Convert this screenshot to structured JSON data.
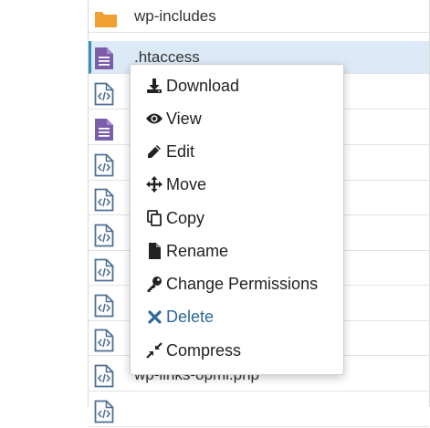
{
  "file_list": {
    "rows": [
      {
        "name": "wp-includes",
        "type": "folder"
      },
      {
        "name": ".htaccess",
        "type": "text",
        "selected": true
      },
      {
        "name": "",
        "type": "code"
      },
      {
        "name": "",
        "type": "text"
      },
      {
        "name": "",
        "type": "code"
      },
      {
        "name": "",
        "type": "code"
      },
      {
        "name": "",
        "type": "code"
      },
      {
        "name": "",
        "type": "code"
      },
      {
        "name": "",
        "type": "code"
      },
      {
        "name": "",
        "type": "code"
      },
      {
        "name": "wp-links-opml.php",
        "type": "code"
      },
      {
        "name": "",
        "type": "code"
      }
    ]
  },
  "context_menu": {
    "items": [
      {
        "label": "Download",
        "icon": "download-icon"
      },
      {
        "label": "View",
        "icon": "eye-icon"
      },
      {
        "label": "Edit",
        "icon": "pencil-icon"
      },
      {
        "label": "Move",
        "icon": "move-icon"
      },
      {
        "label": "Copy",
        "icon": "copy-icon"
      },
      {
        "label": "Rename",
        "icon": "file-icon"
      },
      {
        "label": "Change Permissions",
        "icon": "key-icon"
      },
      {
        "label": "Delete",
        "icon": "close-icon",
        "color": "#2f6899"
      },
      {
        "label": "Compress",
        "icon": "compress-icon"
      }
    ]
  },
  "colors": {
    "folder": "#f0a030",
    "text_file": "#7a5ea8",
    "code_file": "#4f6f93",
    "selected_row": "#dce9f7",
    "delete_text": "#2f6899"
  }
}
